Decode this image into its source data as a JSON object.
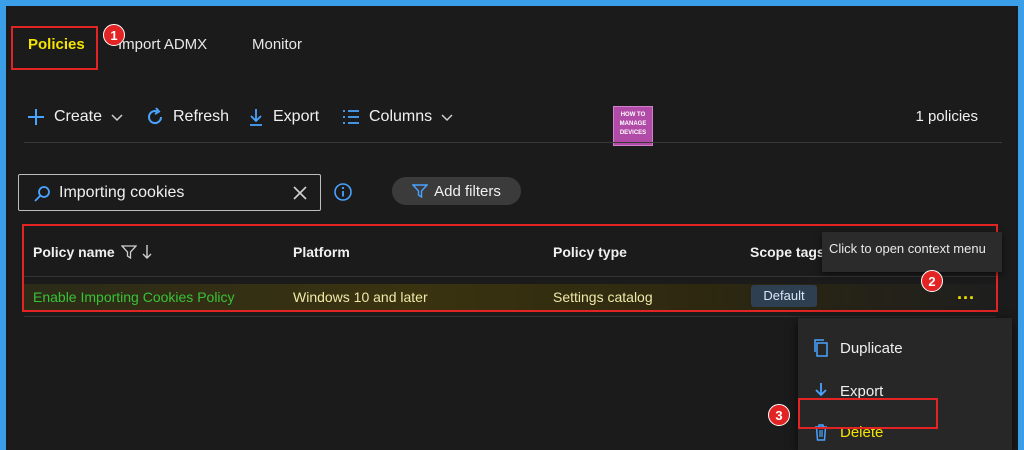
{
  "tabs": [
    {
      "label": "Policies",
      "active": true
    },
    {
      "label": "Import ADMX"
    },
    {
      "label": "Monitor"
    }
  ],
  "toolbar": {
    "create_label": "Create",
    "refresh_label": "Refresh",
    "export_label": "Export",
    "columns_label": "Columns",
    "count_label": "1 policies"
  },
  "logo": {
    "line1": "HOW TO",
    "line2": "MANAGE",
    "line3": "DEVICES"
  },
  "search": {
    "value": "Importing cookies",
    "add_filters_label": "Add filters"
  },
  "table": {
    "columns": [
      "Policy name",
      "Platform",
      "Policy type",
      "Scope tags"
    ],
    "rows": [
      {
        "name": "Enable Importing Cookies Policy",
        "platform": "Windows 10 and later",
        "type": "Settings catalog",
        "scope_tag": "Default"
      }
    ]
  },
  "tooltip": "Click to open context menu",
  "more_label": "...",
  "context_menu": [
    {
      "label": "Duplicate",
      "icon": "copy-icon"
    },
    {
      "label": "Export",
      "icon": "download-icon"
    },
    {
      "label": "Delete",
      "icon": "trash-icon"
    }
  ],
  "annotations": [
    "1",
    "2",
    "3"
  ],
  "colors": {
    "background": "#1b1b1b",
    "frame": "#3a9ee8",
    "accent_yellow": "#f5e400",
    "highlight_red": "#e22424",
    "link_green": "#38c238",
    "icon_blue": "#4aa3ff"
  }
}
